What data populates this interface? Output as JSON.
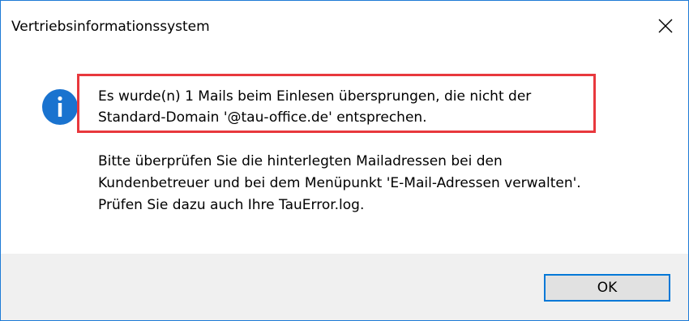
{
  "window": {
    "title": "Vertriebsinformationssystem",
    "close_icon": "close-icon"
  },
  "message": {
    "icon": "info-icon",
    "highlighted_lines": [
      "Es wurde(n) 1 Mails beim Einlesen übersprungen, die nicht der",
      "Standard-Domain '@tau-office.de' entsprechen."
    ],
    "detail_lines": [
      "Bitte überprüfen Sie die hinterlegten Mailadressen bei den",
      "Kundenbetreuer und bei dem Menüpunkt 'E-Mail-Adressen verwalten'.",
      "Prüfen Sie dazu auch Ihre TauError.log."
    ]
  },
  "footer": {
    "ok_label": "OK"
  },
  "colors": {
    "window_border": "#1e7bd6",
    "info_icon": "#1a73cf",
    "highlight_border": "#e8383d",
    "footer_background": "#f0f0f0",
    "button_border": "#0078d7"
  }
}
